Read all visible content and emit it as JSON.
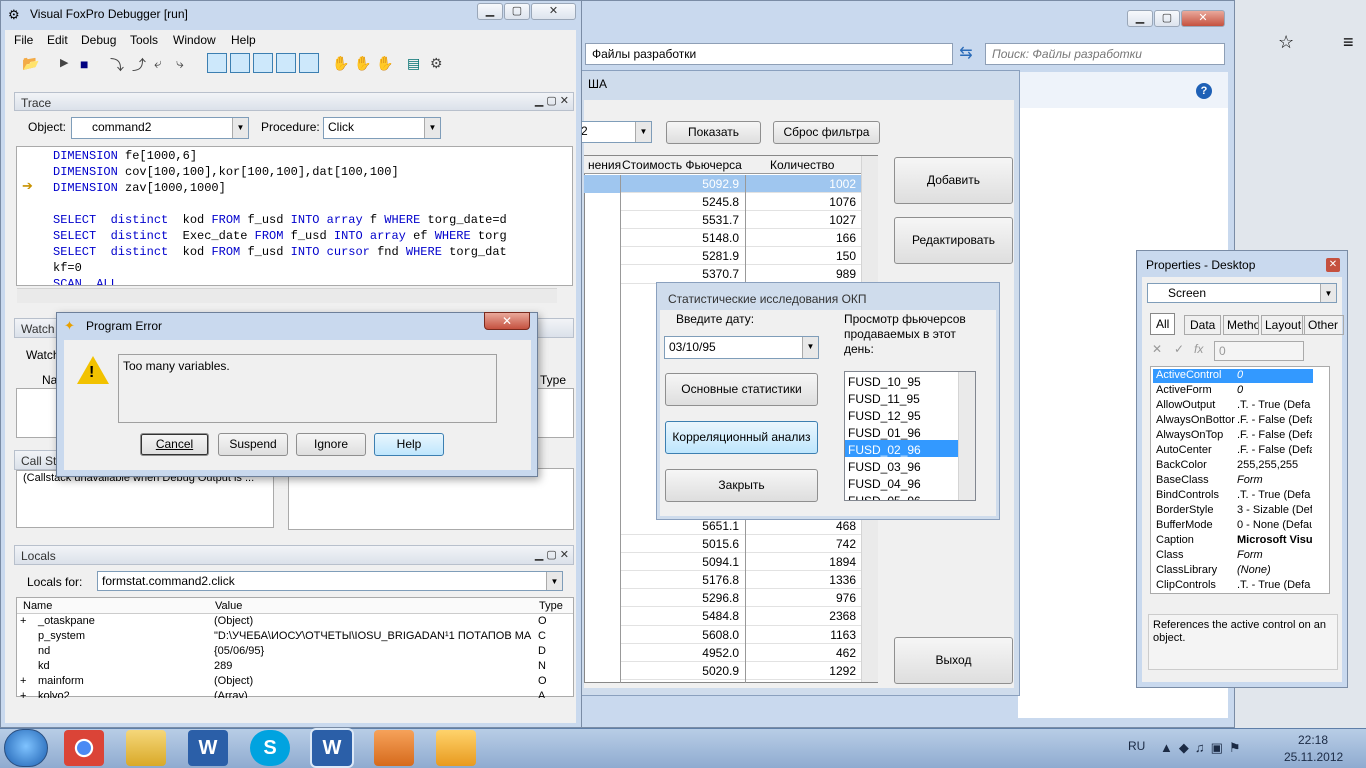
{
  "explorer": {
    "path": "Файлы разработки",
    "search_placeholder": "Поиск: Файлы разработки"
  },
  "form": {
    "title_fragment": "ША",
    "subtitle_fragment": "а",
    "combo_value": "2",
    "show_btn": "Показать",
    "reset_btn": "Сброс фильтра",
    "col_headers": [
      "нения",
      "Стоимость Фьючерса",
      "Количество"
    ],
    "rows": [
      [
        "5092.9",
        "1002"
      ],
      [
        "5245.8",
        "1076"
      ],
      [
        "5531.7",
        "1027"
      ],
      [
        "5148.0",
        "166"
      ],
      [
        "5281.9",
        "150"
      ],
      [
        "5370.7",
        "989"
      ],
      [
        "5651.1",
        "468"
      ],
      [
        "5015.6",
        "742"
      ],
      [
        "5094.1",
        "1894"
      ],
      [
        "5176.8",
        "1336"
      ],
      [
        "5296.8",
        "976"
      ],
      [
        "5484.8",
        "2368"
      ],
      [
        "5608.0",
        "1163"
      ],
      [
        "4952.0",
        "462"
      ],
      [
        "5020.9",
        "1292"
      ]
    ],
    "add_btn": "Добавить",
    "edit_btn": "Редактировать",
    "exit_btn": "Выход"
  },
  "stat": {
    "title": "Статистические исследования ОКП",
    "date_label": "Введите дату:",
    "date_value": "03/10/95",
    "list_label": "Просмотр фьючерсов продаваемых в этот день:",
    "btn_stats": "Основные статистики",
    "btn_corr": "Корреляционный анализ",
    "btn_close": "Закрыть",
    "list": [
      "FUSD_10_95",
      "FUSD_11_95",
      "FUSD_12_95",
      "FUSD_01_96",
      "FUSD_02_96",
      "FUSD_03_96",
      "FUSD_04_96",
      "FUSD_05_96"
    ]
  },
  "debugger": {
    "title": "Visual FoxPro Debugger [run]",
    "menu": [
      "File",
      "Edit",
      "Debug",
      "Tools",
      "Window",
      "Help"
    ],
    "trace": {
      "title": "Trace",
      "object_label": "Object:",
      "object_value": "command2",
      "proc_label": "Procedure:",
      "proc_value": "Click"
    },
    "watch_title": "Watch",
    "watch_label": "Watch",
    "type_label": "Type",
    "name_label": "Na",
    "callstack_title": "Call Sta",
    "callstack_text": "(Callstack unavailable when Debug Output is ...",
    "locals": {
      "title": "Locals",
      "for_label": "Locals for:",
      "for_value": "formstat.command2.click",
      "col_name": "Name",
      "col_value": "Value",
      "col_type": "Type",
      "rows": [
        [
          "+",
          "_otaskpane",
          "(Object)",
          "O"
        ],
        [
          "",
          "p_system",
          "\"D:\\УЧЕБА\\ИОСУ\\ОТЧЕТЫ\\IOSU_BRIGADAN¹1 ПОТАПОВ МА",
          "C"
        ],
        [
          "",
          "nd",
          "{05/06/95}",
          "D"
        ],
        [
          "",
          "kd",
          "289",
          "N"
        ],
        [
          "+",
          "mainform",
          "(Object)",
          "O"
        ],
        [
          "+",
          "kolyo2",
          "(Array)",
          "A"
        ]
      ]
    }
  },
  "error": {
    "title": "Program Error",
    "message": "Too many variables.",
    "cancel": "Cancel",
    "suspend": "Suspend",
    "ignore": "Ignore",
    "help": "Help"
  },
  "props": {
    "title": "Properties - Desktop",
    "object": "Screen",
    "tabs": [
      "All",
      "Data",
      "Metho",
      "Layout",
      "Other"
    ],
    "value_box": "0",
    "rows": [
      [
        "ActiveControl",
        "0"
      ],
      [
        "ActiveForm",
        "0"
      ],
      [
        "AllowOutput",
        ".T. - True (Defa"
      ],
      [
        "AlwaysOnBottor",
        ".F. - False (Defa"
      ],
      [
        "AlwaysOnTop",
        ".F. - False (Defa"
      ],
      [
        "AutoCenter",
        ".F. - False (Defa"
      ],
      [
        "BackColor",
        "255,255,255"
      ],
      [
        "BaseClass",
        "Form"
      ],
      [
        "BindControls",
        ".T. - True (Defa"
      ],
      [
        "BorderStyle",
        "3 - Sizable (Defa"
      ],
      [
        "BufferMode",
        "0 - None (Defau"
      ],
      [
        "Caption",
        "Microsoft Visu"
      ],
      [
        "Class",
        "Form"
      ],
      [
        "ClassLibrary",
        "(None)"
      ],
      [
        "ClipControls",
        ".T. - True (Defa"
      ]
    ],
    "description": "References the active control on an object."
  },
  "taskbar": {
    "lang": "RU",
    "time": "22:18",
    "date": "25.11.2012"
  }
}
